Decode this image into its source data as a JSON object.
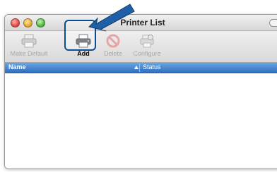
{
  "window": {
    "title": "Printer List"
  },
  "toolbar": {
    "make_default_label": "Make Default",
    "add_label": "Add",
    "delete_label": "Delete",
    "configure_label": "Configure"
  },
  "list": {
    "columns": [
      "Name",
      "Status"
    ],
    "rows": []
  },
  "icons": [
    "close-button",
    "minimize-button",
    "zoom-button",
    "printer-icon",
    "delete-icon",
    "configure-icon",
    "sort-ascending-icon",
    "callout-arrow-icon"
  ],
  "colors": {
    "header_blue": "#2f6fc0",
    "highlight": "#0b4d8f",
    "arrow": "#1e5fa8"
  }
}
